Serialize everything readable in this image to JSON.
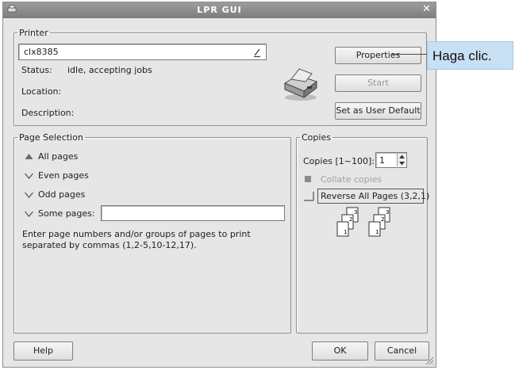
{
  "window": {
    "title": "LPR GUI",
    "close_glyph": "✕"
  },
  "printer": {
    "legend": "Printer",
    "name": "clx8385",
    "status_label": "Status:",
    "status_value": "idle, accepting jobs",
    "location_label": "Location:",
    "description_label": "Description:",
    "properties_button": "Properties",
    "start_button": "Start",
    "set_default_button": "Set as User Default"
  },
  "callout": {
    "text": "Haga clic."
  },
  "page_selection": {
    "legend": "Page Selection",
    "options": [
      "All pages",
      "Even pages",
      "Odd pages",
      "Some pages:"
    ],
    "selected": "All pages",
    "hint": "Enter page numbers and/or groups of pages to print separated by commas (1,2-5,10-12,17)."
  },
  "copies": {
    "legend": "Copies",
    "copies_label": "Copies [1~100]:",
    "copies_value": "1",
    "collate_label": "Collate copies",
    "reverse_label": "Reverse All Pages (3,2,1)",
    "page_numbers": [
      "1",
      "2",
      "3"
    ]
  },
  "footer": {
    "help_button": "Help",
    "ok_button": "OK",
    "cancel_button": "Cancel"
  }
}
